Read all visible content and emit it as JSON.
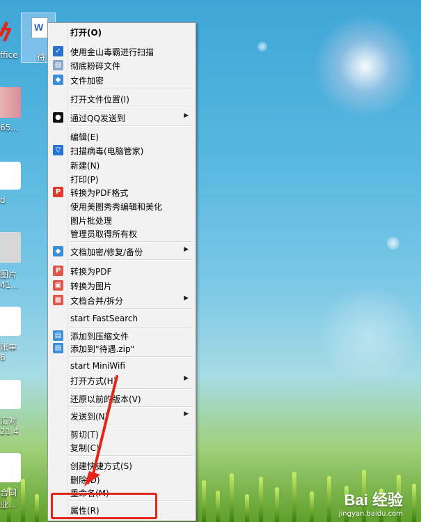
{
  "desktop": {
    "labels": [
      "ffice",
      "65...",
      "d",
      "图片",
      "41...",
      "账单",
      "6",
      "汇对",
      "21.4",
      "合同",
      "业..."
    ],
    "selected_file_label": "待"
  },
  "menu": {
    "items": [
      {
        "label": "打开(O)",
        "icon": "",
        "bold": true
      },
      {
        "label": "使用金山毒霸进行扫描",
        "icon": "duba-icon",
        "color": "#2a72d0"
      },
      {
        "label": "彻底粉碎文件",
        "icon": "shredder-icon",
        "color": "#8aa6c8"
      },
      {
        "label": "文件加密",
        "icon": "shield-icon",
        "color": "#3a8fd8"
      },
      {
        "label": "打开文件位置(I)",
        "icon": ""
      },
      {
        "label": "通过QQ发送到",
        "icon": "qq-icon",
        "color": "#111",
        "submenu": true
      },
      {
        "label": "编辑(E)",
        "icon": ""
      },
      {
        "label": "扫描病毒(电脑管家)",
        "icon": "guanjia-icon",
        "color": "#2474d6"
      },
      {
        "label": "新建(N)",
        "icon": ""
      },
      {
        "label": "打印(P)",
        "icon": ""
      },
      {
        "label": "转换为PDF格式",
        "icon": "pdf-icon",
        "color": "#e03a2e"
      },
      {
        "label": "使用美图秀秀编辑和美化",
        "icon": ""
      },
      {
        "label": "图片批处理",
        "icon": ""
      },
      {
        "label": "管理员取得所有权",
        "icon": ""
      },
      {
        "label": "文档加密/修复/备份",
        "icon": "doc-shield-icon",
        "color": "#3a8fd8",
        "submenu": true
      },
      {
        "label": "转换为PDF",
        "icon": "convert-pdf-icon",
        "color": "#e0554a"
      },
      {
        "label": "转换为图片",
        "icon": "convert-image-icon",
        "color": "#e0554a"
      },
      {
        "label": "文档合并/拆分",
        "icon": "merge-icon",
        "color": "#e0554a",
        "submenu": true
      },
      {
        "label": "start FastSearch",
        "icon": ""
      },
      {
        "label": "添加到压缩文件",
        "icon": "archive-icon",
        "color": "#3b8fd6"
      },
      {
        "label": "添加到\"待遇.zip\"",
        "icon": "archive-zip-icon",
        "color": "#3b8fd6"
      },
      {
        "label": "start MiniWifi",
        "icon": ""
      },
      {
        "label": "打开方式(H)",
        "icon": "",
        "submenu": true
      },
      {
        "label": "还原以前的版本(V)",
        "icon": ""
      },
      {
        "label": "发送到(N)",
        "icon": "",
        "submenu": true
      },
      {
        "label": "剪切(T)",
        "icon": ""
      },
      {
        "label": "复制(C)",
        "icon": ""
      },
      {
        "label": "创建快捷方式(S)",
        "icon": ""
      },
      {
        "label": "删除(D)",
        "icon": ""
      },
      {
        "label": "重命名(M)",
        "icon": ""
      },
      {
        "label": "属性(R)",
        "icon": ""
      }
    ]
  },
  "watermark": {
    "brand": "Bai 经验",
    "url": "jingyan.baidu.com"
  },
  "colors": {
    "highlight": "#e3261a",
    "menu_bg": "#f2f2f2"
  }
}
